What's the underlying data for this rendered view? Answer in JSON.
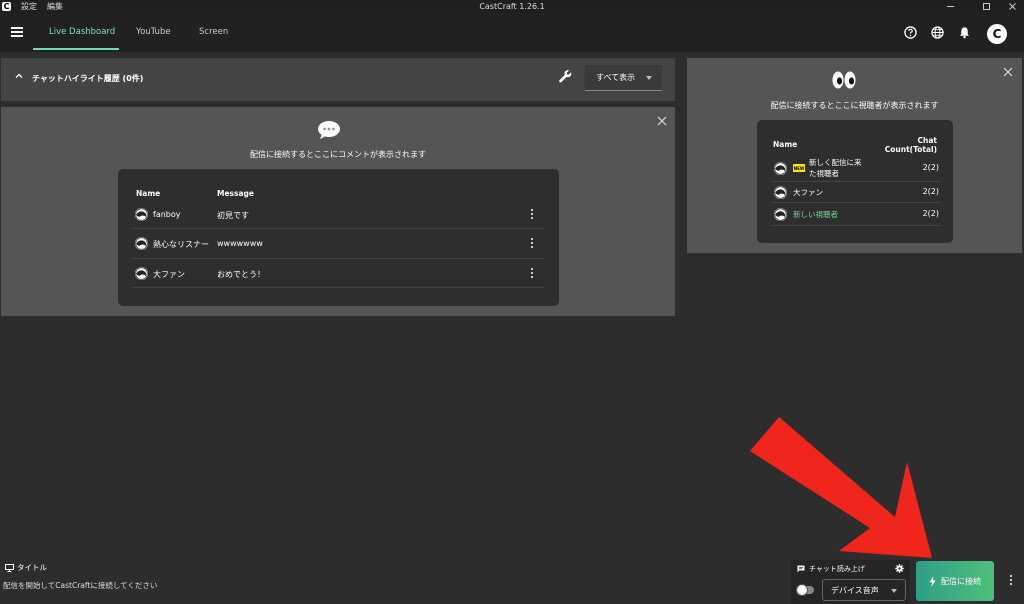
{
  "titlebar": {
    "app_letter": "C",
    "menu_settings": "設定",
    "menu_edit": "編集",
    "window_title": "CastCraft 1.26.1"
  },
  "nav": {
    "tabs": [
      "Live Dashboard",
      "YouTube",
      "Screen"
    ],
    "avatar_letter": "C"
  },
  "highlight_header": {
    "title": "チャットハイライト履歴 (0件)",
    "filter_value": "すべて表示"
  },
  "chat_panel": {
    "caption": "配信に接続するとここにコメントが表示されます",
    "col_name": "Name",
    "col_message": "Message",
    "rows": [
      {
        "name": "fanboy",
        "message": "初見です"
      },
      {
        "name": "熱心なリスナー",
        "message": "wwwwwww"
      },
      {
        "name": "大ファン",
        "message": "おめでとう！"
      }
    ]
  },
  "viewer_panel": {
    "caption": "配信に接続するとここに視聴者が表示されます",
    "col_name": "Name",
    "col_count_line1": "Chat",
    "col_count_line2": "Count(Total)",
    "rows": [
      {
        "name_line1": "新しく配信に来",
        "name_line2": "た視聴者",
        "count": "2(2)",
        "badge": "NEW"
      },
      {
        "name": "大ファン",
        "count": "2(2)"
      },
      {
        "name": "新しい視聴者",
        "count": "2(2)",
        "color": "#6fdc8c"
      }
    ]
  },
  "footer": {
    "title_label": "タイトル",
    "status": "配信を開始してCastCraftに接続してください",
    "tts_label": "チャット読み上げ",
    "device_value": "デバイス音声",
    "connect_label": "配信に接続"
  },
  "colors": {
    "accent": "#6fdcad",
    "connect_start": "#2e9e86",
    "connect_end": "#4fc07a",
    "arrow": "#f0251c"
  }
}
